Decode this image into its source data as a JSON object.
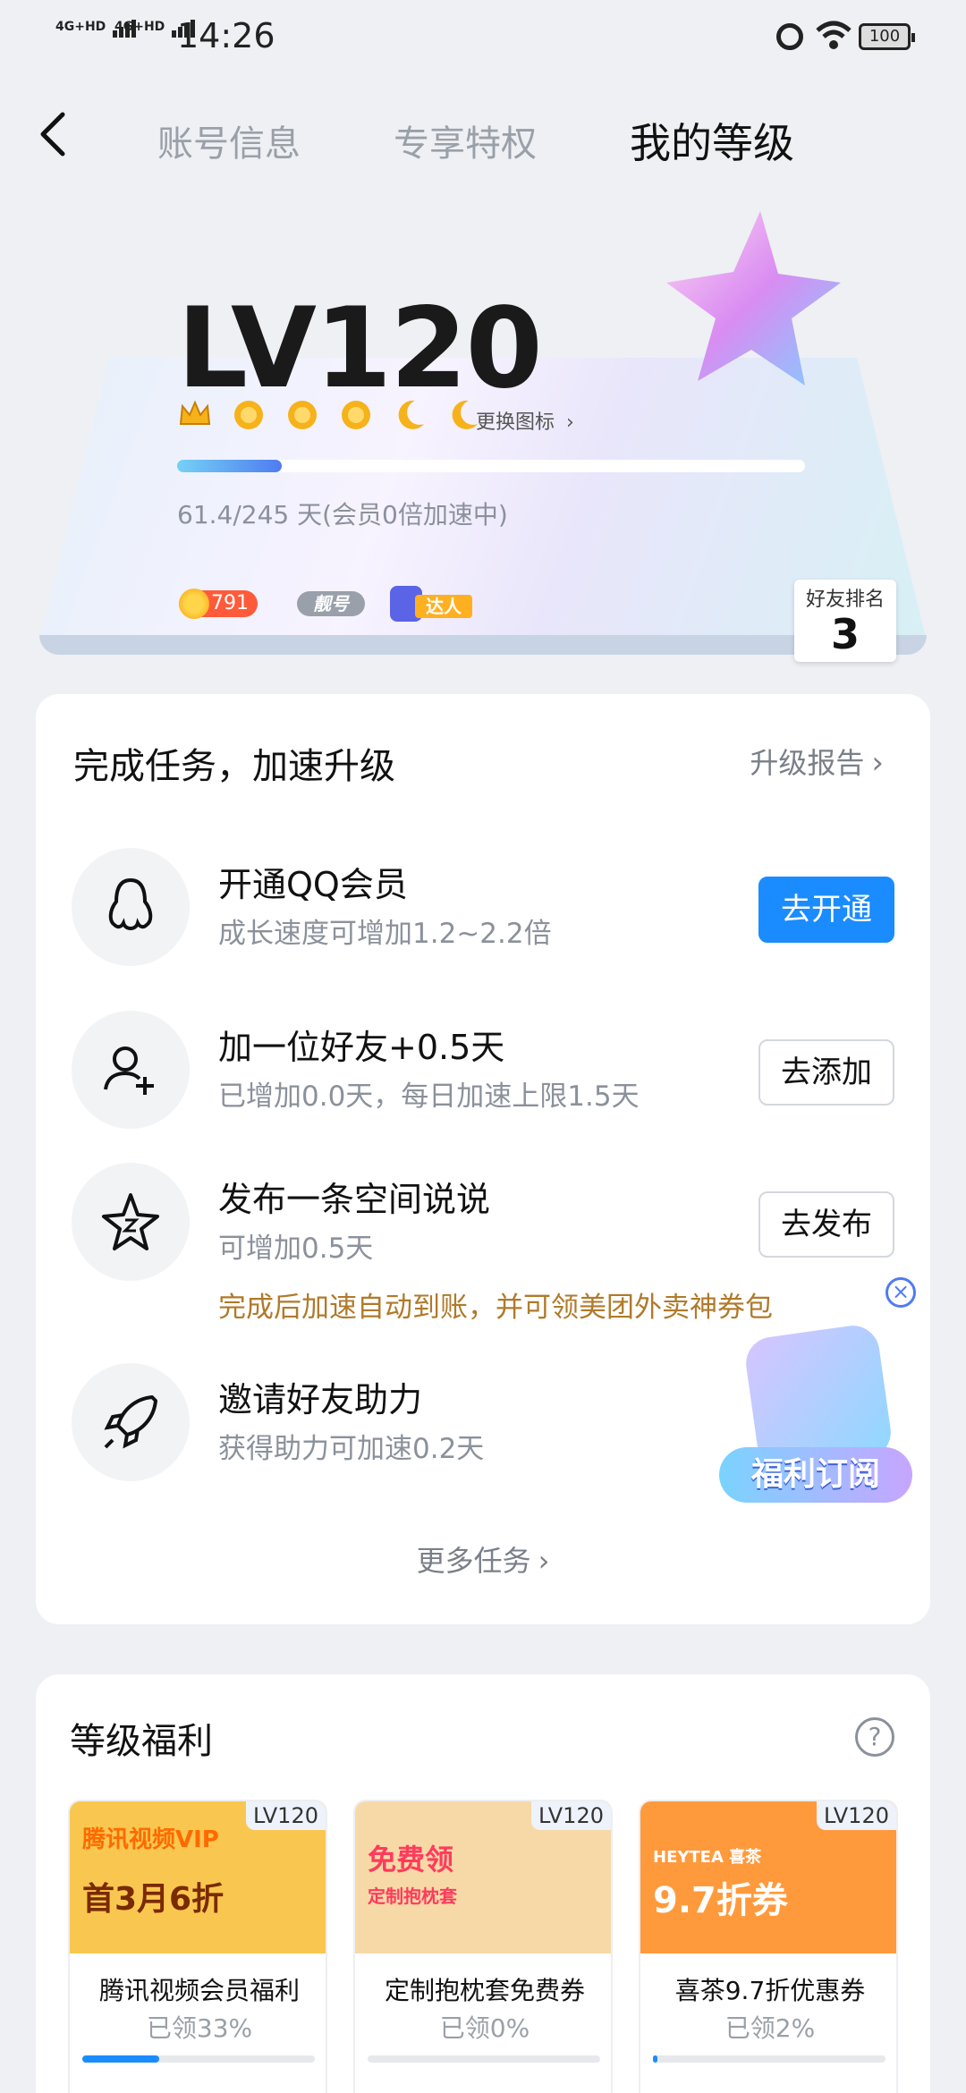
{
  "status_bar": {
    "network1": "4G+HD",
    "network2": "4G+HD",
    "time": "14:26",
    "battery": "100"
  },
  "header": {
    "tabs": [
      {
        "label": "账号信息",
        "active": false
      },
      {
        "label": "专享特权",
        "active": false
      },
      {
        "label": "我的等级",
        "active": true
      }
    ]
  },
  "level_card": {
    "level": "LV120",
    "change_icon_label": "更换图标",
    "progress_text": "61.4/245 天(会员0倍加速中)",
    "progress_fraction": 0.1673,
    "coin_count": "791",
    "liang_label": "靓号",
    "daren_label": "达人",
    "rank_label": "好友排名",
    "rank_value": "3",
    "badges": [
      "crown-icon",
      "sun-icon",
      "sun-icon",
      "sun-icon",
      "moon-icon",
      "moon-icon"
    ]
  },
  "tasks": {
    "title": "完成任务，加速升级",
    "report_label": "升级报告",
    "items": [
      {
        "icon": "penguin-icon",
        "name": "开通QQ会员",
        "desc": "成长速度可增加1.2~2.2倍",
        "button": "去开通",
        "primary": true
      },
      {
        "icon": "add-friend-icon",
        "name": "加一位好友+0.5天",
        "desc": "已增加0.0天，每日加速上限1.5天",
        "button": "去添加",
        "primary": false
      },
      {
        "icon": "space-star-icon",
        "name": "发布一条空间说说",
        "desc": "可增加0.5天",
        "button": "去发布",
        "primary": false
      },
      {
        "icon": "rocket-icon",
        "name": "邀请好友助力",
        "desc": "获得助力可加速0.2天",
        "button": "",
        "primary": false
      }
    ],
    "tip": "完成后加速自动到账，并可领美团外卖神券包",
    "more_label": "更多任务",
    "promo_label": "福利订阅"
  },
  "benefits": {
    "title": "等级福利",
    "items": [
      {
        "tag": "LV120",
        "name": "腾讯视频会员福利",
        "claimed": "已领33%",
        "fraction": 0.33,
        "banner_line1": "腾讯视频VIP",
        "banner_line2": "首3月6折",
        "color": "#f9c74f"
      },
      {
        "tag": "LV120",
        "name": "定制抱枕套免费券",
        "claimed": "已领0%",
        "fraction": 0.0,
        "banner_line1": "免费领",
        "banner_line2": "定制抱枕套",
        "color": "#f7d9a8"
      },
      {
        "tag": "LV120",
        "name": "喜茶9.7折优惠券",
        "claimed": "已领2%",
        "fraction": 0.02,
        "banner_line1": "HEYTEA 喜茶",
        "banner_line2": "9.7折券",
        "color": "#ff9a3c"
      }
    ]
  },
  "colors": {
    "accent": "#1a8cff",
    "tip": "#b07a2a",
    "coin": "#ff5a3a"
  }
}
